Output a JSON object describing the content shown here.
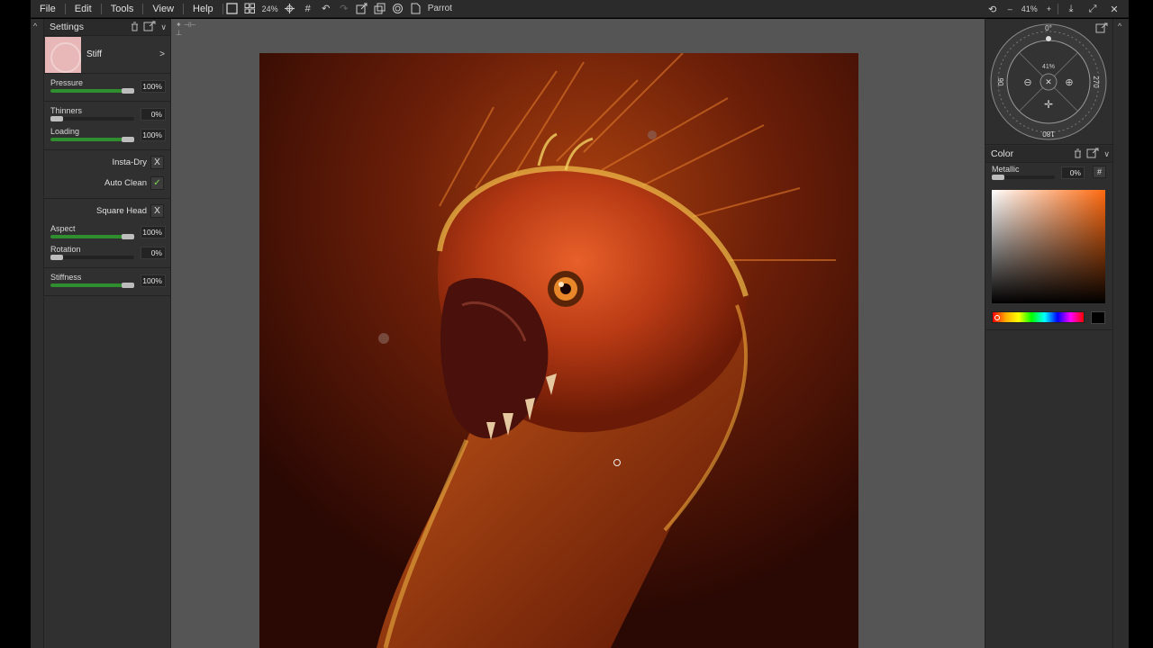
{
  "menubar": {
    "file": "File",
    "edit": "Edit",
    "tools": "Tools",
    "view": "View",
    "help": "Help",
    "zoom_value": "24%",
    "document_name": "Parrot",
    "right_zoom": "41%",
    "right_zoom_minus": "–",
    "right_zoom_plus": "+"
  },
  "settings_panel": {
    "title": "Settings",
    "brush_name": "Stiff",
    "brush_arrow": ">",
    "params": [
      {
        "label": "Pressure",
        "value": "100%",
        "level": 1.0
      },
      {
        "label": "Thinners",
        "value": "0%",
        "level": 0.0
      },
      {
        "label": "Loading",
        "value": "100%",
        "level": 1.0
      },
      {
        "label": "Aspect",
        "value": "100%",
        "level": 1.0
      },
      {
        "label": "Rotation",
        "value": "0%",
        "level": 0.0
      },
      {
        "label": "Stiffness",
        "value": "100%",
        "level": 1.0
      }
    ],
    "toggles": [
      {
        "label": "Insta-Dry",
        "mark": "X"
      },
      {
        "label": "Auto Clean",
        "mark": "✓"
      },
      {
        "label": "Square Head",
        "mark": "X"
      }
    ]
  },
  "navigator": {
    "top_angle": "0°",
    "left_angle": "90",
    "right_angle": "270",
    "bottom_angle": "180",
    "zoom": "41%"
  },
  "color_panel": {
    "title": "Color",
    "metallic_label": "Metallic",
    "metallic_value": "0%",
    "hash_label": "#",
    "metallic_level": 0.0,
    "accent_color": "#ff6a10"
  },
  "colors": {
    "slider_fill": "#2f8f2f",
    "canvas_bg": "#555555",
    "panel_bg": "#303030"
  }
}
